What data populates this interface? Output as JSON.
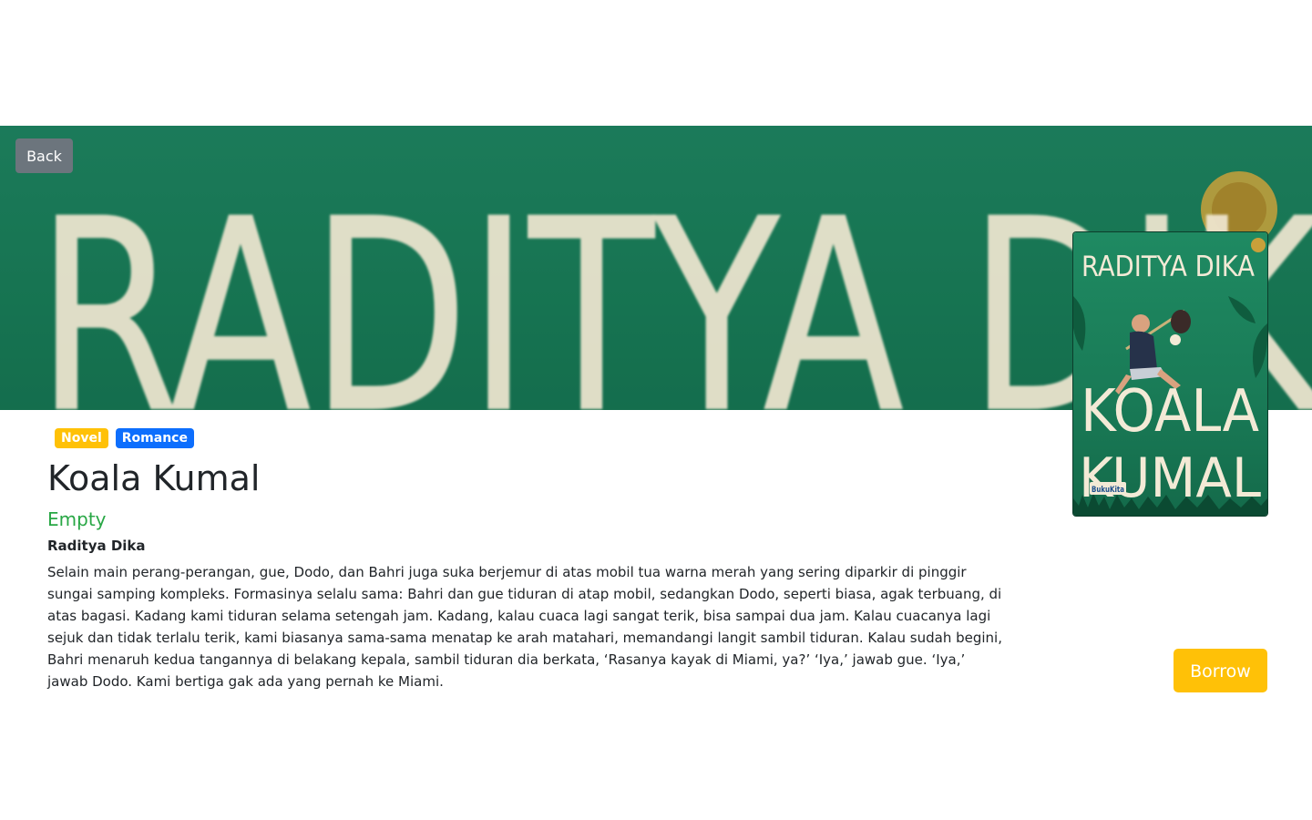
{
  "nav": {
    "back_label": "Back"
  },
  "banner": {
    "text": "RADITYA DIKA"
  },
  "book": {
    "tags": [
      "Novel",
      "Romance"
    ],
    "title": "Koala Kumal",
    "status": "Empty",
    "author": "Raditya Dika",
    "description": "Selain main perang-perangan, gue, Dodo, dan Bahri juga suka berjemur di atas mobil tua warna merah yang sering diparkir di pinggir sungai samping kompleks. Formasinya selalu sama: Bahri dan gue tiduran di atap mobil, sedangkan Dodo, seperti biasa, agak terbuang, di atas bagasi. Kadang kami tiduran selama setengah jam. Kadang, kalau cuaca lagi sangat terik, bisa sampai dua jam. Kalau cuacanya lagi sejuk dan tidak terlalu terik, kami biasanya sama-sama menatap ke arah matahari, memandangi langit sambil tiduran. Kalau sudah begini, Bahri menaruh kedua tangannya di belakang kepala, sambil tiduran dia berkata, ‘Rasanya kayak di Miami, ya?’ ‘Iya,’ jawab gue. ‘Iya,’ jawab Dodo. Kami bertiga gak ada yang pernah ke Miami.",
    "cover": {
      "author_text": "RADITYA DIKA",
      "title_line1": "KOALA",
      "title_line2": "KUMAL",
      "publisher": "BukuKita"
    },
    "borrow_label": "Borrow"
  },
  "colors": {
    "banner_green": "#177552",
    "back_button": "#6c757d",
    "badge_novel": "#ffc107",
    "badge_romance": "#0d6efd",
    "status_text": "#28a745",
    "borrow_button": "#ffc107"
  }
}
